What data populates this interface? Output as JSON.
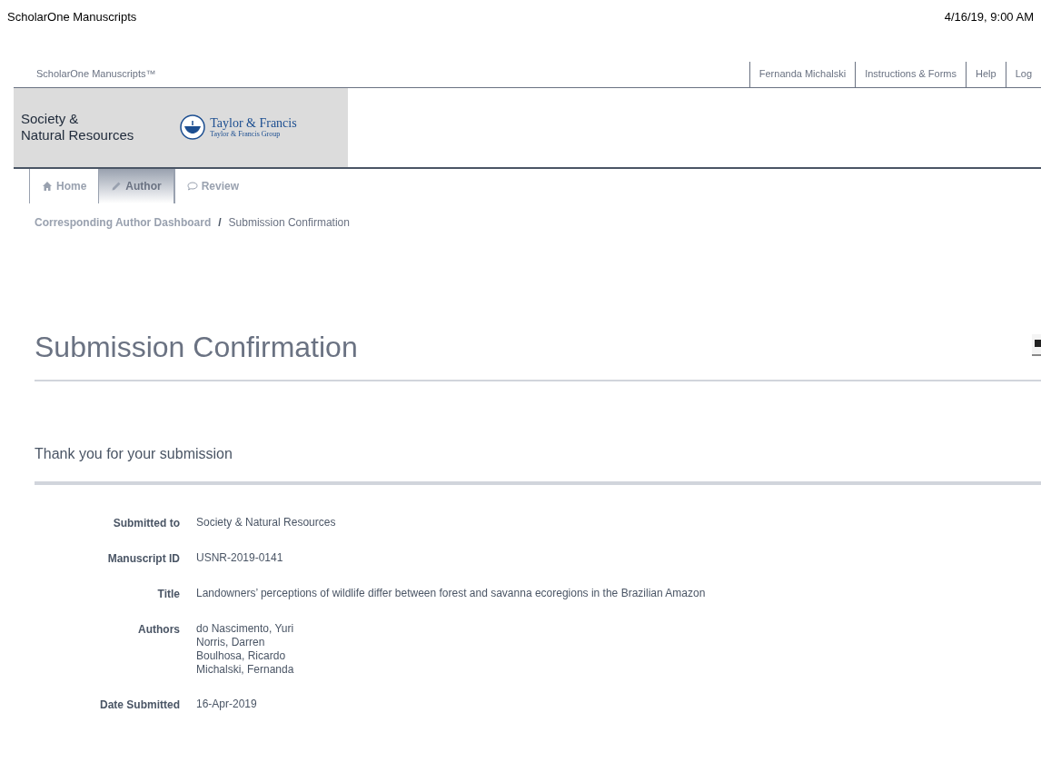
{
  "window": {
    "title": "ScholarOne Manuscripts",
    "timestamp": "4/16/19, 9:00 AM"
  },
  "top_nav": {
    "brand": "ScholarOne Manuscripts™",
    "links": [
      "Fernanda Michalski",
      "Instructions & Forms",
      "Help",
      "Log"
    ]
  },
  "banner": {
    "journal_lines": [
      "Society &",
      "Natural Resources"
    ],
    "publisher": "Taylor & Francis",
    "publisher_group": "Taylor & Francis Group"
  },
  "tabs": [
    {
      "label": "Home",
      "selected": false
    },
    {
      "label": "Author",
      "selected": true
    },
    {
      "label": "Review",
      "selected": false
    }
  ],
  "breadcrumb": {
    "parent": "Corresponding Author Dashboard",
    "separator": "/",
    "current": "Submission Confirmation"
  },
  "heading": "Submission Confirmation",
  "subheading": "Thank you for your submission",
  "details": [
    {
      "label": "Submitted to",
      "values": [
        "Society & Natural Resources"
      ]
    },
    {
      "label": "Manuscript ID",
      "values": [
        "USNR-2019-0141"
      ]
    },
    {
      "label": "Title",
      "values": [
        "Landowners’ perceptions of wildlife differ between forest and savanna ecoregions in the Brazilian Amazon"
      ]
    },
    {
      "label": "Authors",
      "values": [
        "do Nascimento, Yuri",
        "Norris, Darren",
        "Boulhosa, Ricardo",
        "Michalski, Fernanda"
      ]
    },
    {
      "label": "Date Submitted",
      "values": [
        "16-Apr-2019"
      ]
    }
  ]
}
